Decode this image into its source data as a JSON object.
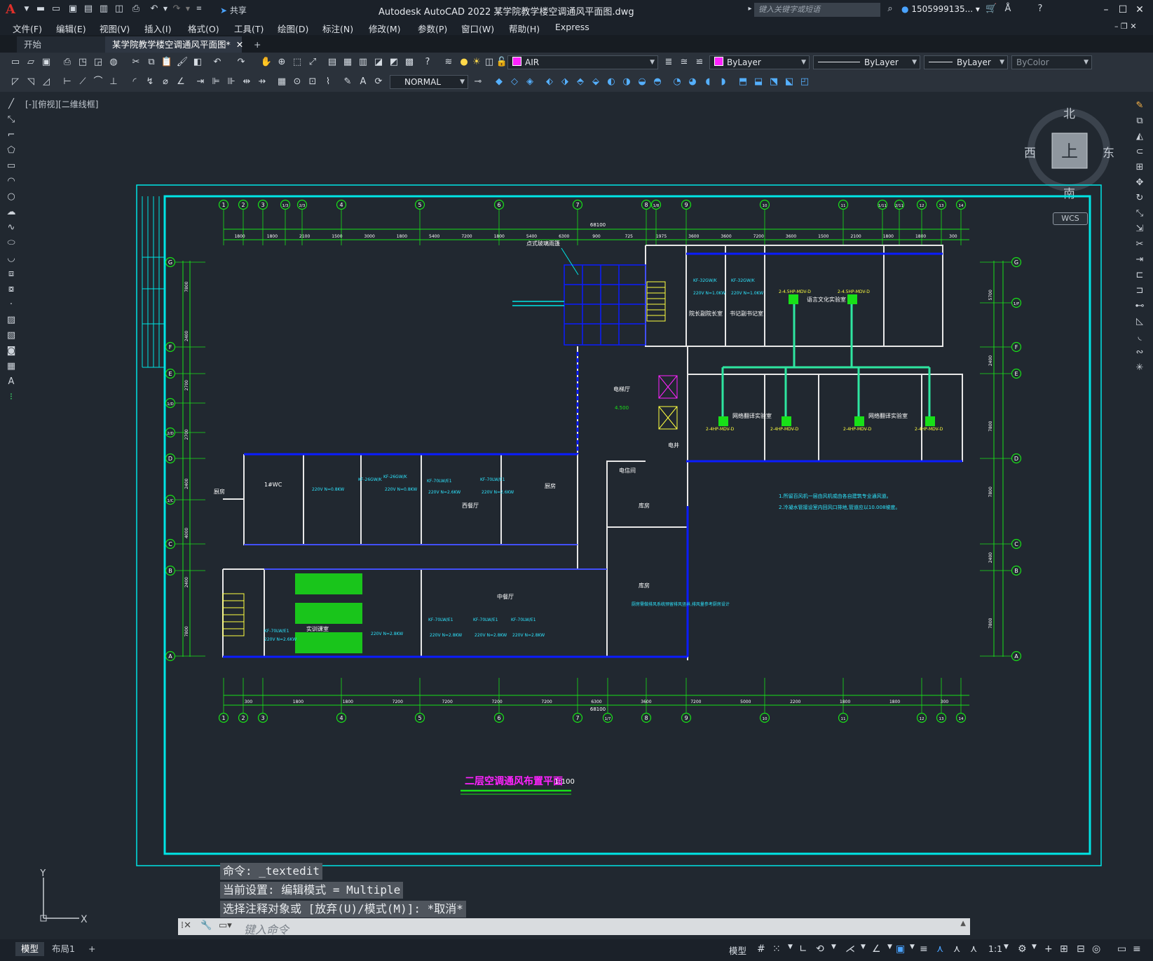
{
  "app": {
    "title": "Autodesk AutoCAD 2022    某学院教学楼空调通风平面图.dwg",
    "logo": "A",
    "share_label": "共享",
    "search_placeholder": "键入关键字或短语",
    "user": "1505999135...",
    "colors": {
      "accent": "#e0302a",
      "frame": "#00e5e5",
      "wall": "#ffffff",
      "duct": "#0a1cff",
      "axis": "#18e018",
      "text_cyan": "#2ee6ff",
      "title_magenta": "#ff22ff",
      "label_yellow": "#ffff40"
    }
  },
  "menu": [
    "文件(F)",
    "编辑(E)",
    "视图(V)",
    "插入(I)",
    "格式(O)",
    "工具(T)",
    "绘图(D)",
    "标注(N)",
    "修改(M)",
    "参数(P)",
    "窗口(W)",
    "帮助(H)",
    "Express"
  ],
  "tabs": [
    {
      "label": "开始",
      "active": false
    },
    {
      "label": "某学院教学楼空调通风平面图*",
      "active": true
    }
  ],
  "toolbar": {
    "layer": "AIR",
    "color": "ByLayer",
    "linetype": "ByLayer",
    "lineweight": "ByLayer",
    "plotstyle": "ByColor",
    "textstyle": "NORMAL"
  },
  "viewport": {
    "label": "[-][俯视][二维线框]"
  },
  "viewcube": {
    "north": "北",
    "south": "南",
    "east": "东",
    "west": "西",
    "top": "上",
    "wcs": "WCS"
  },
  "command": {
    "history": [
      "命令: _textedit",
      "当前设置: 编辑模式 = Multiple",
      "选择注释对象或 [放弃(U)/模式(M)]: *取消*"
    ],
    "placeholder": "键入命令"
  },
  "layouts": [
    {
      "label": "模型",
      "active": true
    },
    {
      "label": "布局1",
      "active": false
    }
  ],
  "status": {
    "model_label": "模型",
    "scale": "1:1"
  },
  "drawing": {
    "title": "二层空调通风布置平面",
    "scale": "1:100",
    "top_axis_labels": [
      "1",
      "2",
      "3",
      "1/3",
      "2/3",
      "4",
      "5",
      "6",
      "7",
      "8",
      "1/8",
      "9",
      "10",
      "11",
      "1/11",
      "2/11",
      "12",
      "13",
      "14"
    ],
    "bottom_axis_labels": [
      "1",
      "2",
      "3",
      "4",
      "5",
      "6",
      "7",
      "1/7",
      "8",
      "9",
      "10",
      "11",
      "12",
      "13",
      "14"
    ],
    "left_axis_labels": [
      "G",
      "F",
      "E",
      "1/D",
      "2/D",
      "D",
      "1/C",
      "C",
      "B",
      "A"
    ],
    "right_axis_labels": [
      "G",
      "1/F",
      "F",
      "E",
      "D",
      "C",
      "B",
      "A"
    ],
    "top_dims": [
      "1800",
      "1800",
      "2100",
      "1500",
      "3000",
      "1800",
      "5400",
      "7200",
      "1800",
      "5400",
      "6300",
      "900",
      "725",
      "1975",
      "3600",
      "3600",
      "7200",
      "3600",
      "1500",
      "2100",
      "1800",
      "1800",
      "300"
    ],
    "bottom_dims": [
      "300",
      "1800",
      "1800",
      "7200",
      "7200",
      "7200",
      "7200",
      "6300",
      "3600",
      "7200",
      "5000",
      "2200",
      "1800",
      "1800",
      "300"
    ],
    "overall_dim": "68100",
    "left_dims": [
      "7800",
      "2400",
      "2700",
      "2700",
      "2400",
      "4000",
      "2400",
      "7800"
    ],
    "right_dims": [
      "5700",
      "2400",
      "7800",
      "7800",
      "2400",
      "7800"
    ],
    "rooms": [
      {
        "name": "院长副院长室"
      },
      {
        "name": "书记副书记室"
      },
      {
        "name": "语言文化实验室"
      },
      {
        "name": "网络翻译实验室"
      },
      {
        "name": "网络翻译实验室"
      },
      {
        "name": "电梯厅"
      },
      {
        "name": "电信间"
      },
      {
        "name": "库房"
      },
      {
        "name": "库房"
      },
      {
        "name": "西餐厅"
      },
      {
        "name": "厨房"
      },
      {
        "name": "中餐厅"
      },
      {
        "name": "实训课室"
      },
      {
        "name": "厨房"
      },
      {
        "name": "1#WC"
      },
      {
        "name": "点式玻璃雨篷"
      },
      {
        "name": "电井"
      }
    ],
    "equipment": [
      {
        "label": "2-4.5HP-MDV-D"
      },
      {
        "label": "2-4.5HP-MDV-D"
      },
      {
        "label": "2-4HP-MDV-D"
      },
      {
        "label": "2-4HP-MDV-D"
      },
      {
        "label": "2-4HP-MDV-D"
      },
      {
        "label": "2-4HP-MDV-D"
      },
      {
        "label": "KF-32GW/K"
      },
      {
        "label": "KF-32GW/K"
      },
      {
        "label": "KF-26GW/K"
      },
      {
        "label": "KF-26GW/K"
      },
      {
        "label": "KF-70LW/E1"
      },
      {
        "label": "KF-70LW/E1"
      },
      {
        "label": "KF-70LW/E1"
      },
      {
        "label": "KF-70LW/E1"
      },
      {
        "label": "KF-70LW/E1"
      },
      {
        "label": "KF-70LW/E1"
      }
    ],
    "power_labels": [
      "220V N=1.0KW",
      "220V N=1.0KW",
      "220V N=0.8KW",
      "220V N=0.8KW",
      "220V N=2.6KW",
      "220V N=2.6KW",
      "220V N=2.6KW",
      "220V N=2.8KW",
      "220V N=2.8KW",
      "220V N=2.8KW",
      "220V N=2.8KW"
    ],
    "notes": [
      "1.所留百风机一层由风机或由各自建筑专业通风道。",
      "2.冷凝水管接设室内回风口排地,管道应以10.008坡度。"
    ],
    "level": "4.500",
    "canopy": "点式玻璃雨篷",
    "kitchen_note": "厨房需做排风系统预留排风竖井,排风量参考厨房设计"
  }
}
